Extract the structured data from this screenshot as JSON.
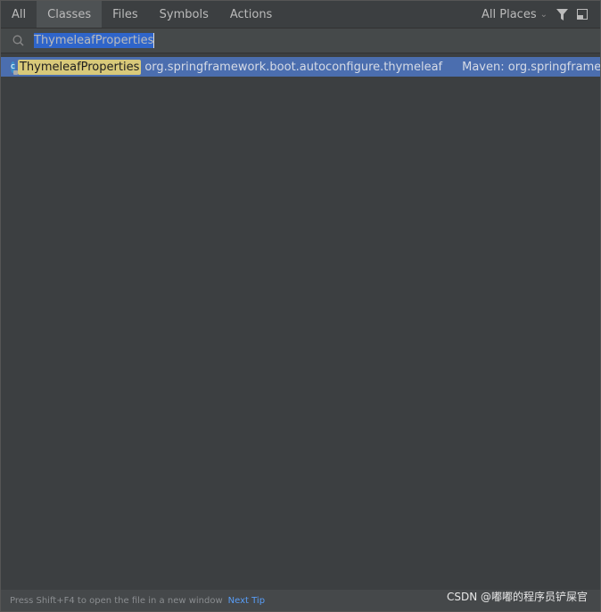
{
  "tabs": [
    {
      "label": "All"
    },
    {
      "label": "Classes",
      "active": true
    },
    {
      "label": "Files"
    },
    {
      "label": "Symbols"
    },
    {
      "label": "Actions"
    }
  ],
  "scope": {
    "label": "All Places"
  },
  "search": {
    "value": "ThymeleafProperties"
  },
  "results": [
    {
      "name": "ThymeleafProperties",
      "package": "org.springframework.boot.autoconfigure.thymeleaf",
      "location": "Maven: org.springframework.boot",
      "icon": "class-icon"
    }
  ],
  "footer": {
    "tip": "Press Shift+F4 to open the file in a new window",
    "next_tip": "Next Tip"
  },
  "watermark": "CSDN @嘟嘟的程序员铲屎官",
  "colors": {
    "selection": "#4b6eaf",
    "match_highlight": "#d8c97a",
    "link": "#589df6"
  }
}
